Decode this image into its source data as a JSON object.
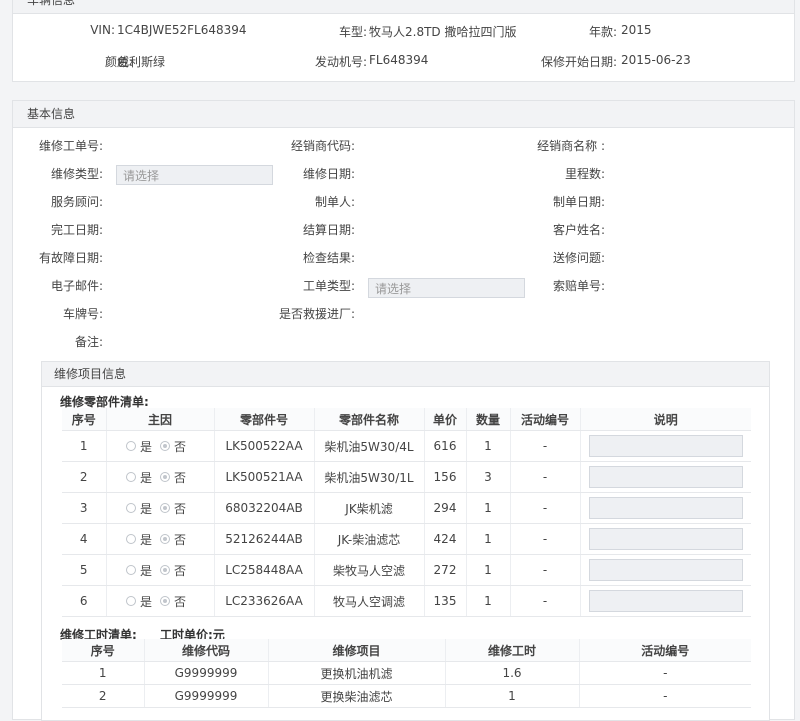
{
  "vehicle": {
    "header": "车辆信息",
    "vin_label": "VIN:",
    "vin": "1C4BJWE52FL648394",
    "model_label": "车型:",
    "model": "牧马人2.8TD 撒哈拉四门版",
    "year_label": "年款:",
    "year": "2015",
    "color_label": "颜色:",
    "color": "威利斯绿",
    "engine_label": "发动机号:",
    "engine": "FL648394",
    "warranty_label": "保修开始日期:",
    "warranty": "2015-06-23"
  },
  "basic": {
    "header": "基本信息",
    "rows": [
      [
        "维修工单号:",
        "经销商代码:",
        "经销商名称 :"
      ],
      [
        "维修类型:",
        "维修日期:",
        "里程数:"
      ],
      [
        "服务顾问:",
        "制单人:",
        "制单日期:"
      ],
      [
        "完工日期:",
        "结算日期:",
        "客户姓名:"
      ],
      [
        "有故障日期:",
        "检查结果:",
        "送修问题:"
      ],
      [
        "电子邮件:",
        "工单类型:",
        "索赔单号:"
      ],
      [
        "车牌号:",
        "是否救援进厂:",
        ""
      ],
      [
        "备注:",
        "",
        ""
      ]
    ],
    "repair_type_placeholder": "请选择",
    "order_type_placeholder": "请选择"
  },
  "repair": {
    "header": "维修项目信息",
    "parts_title": "维修零部件清单:",
    "parts_columns": [
      "序号",
      "主因",
      "零部件号",
      "零部件名称",
      "单价",
      "数量",
      "活动编号",
      "说明"
    ],
    "yes": "是",
    "no": "否",
    "parts": [
      {
        "no": "1",
        "part": "LK500522AA",
        "name": "柴机油5W30/4L",
        "price": "616",
        "qty": "1",
        "act": "-"
      },
      {
        "no": "2",
        "part": "LK500521AA",
        "name": "柴机油5W30/1L",
        "price": "156",
        "qty": "3",
        "act": "-"
      },
      {
        "no": "3",
        "part": "68032204AB",
        "name": "JK柴机滤",
        "price": "294",
        "qty": "1",
        "act": "-"
      },
      {
        "no": "4",
        "part": "52126244AB",
        "name": "JK-柴油滤芯",
        "price": "424",
        "qty": "1",
        "act": "-"
      },
      {
        "no": "5",
        "part": "LC258448AA",
        "name": "柴牧马人空滤",
        "price": "272",
        "qty": "1",
        "act": "-"
      },
      {
        "no": "6",
        "part": "LC233626AA",
        "name": "牧马人空调滤",
        "price": "135",
        "qty": "1",
        "act": "-"
      }
    ],
    "labor_title": "维修工时清单:",
    "labor_unit_price": "工时单价:元",
    "labor_columns": [
      "序号",
      "维修代码",
      "维修项目",
      "维修工时",
      "活动编号"
    ],
    "labor": [
      {
        "no": "1",
        "code": "G9999999",
        "item": "更换机油机滤",
        "hours": "1.6",
        "act": "-"
      },
      {
        "no": "2",
        "code": "G9999999",
        "item": "更换柴油滤芯",
        "hours": "1",
        "act": "-"
      }
    ]
  }
}
